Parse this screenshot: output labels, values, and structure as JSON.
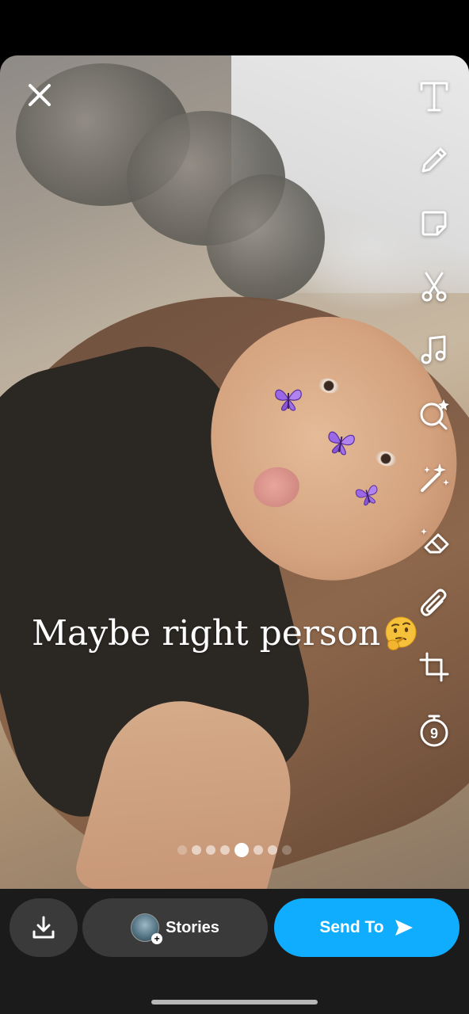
{
  "caption": {
    "text": "Maybe  right person",
    "emoji_icon": "thinking-face-icon"
  },
  "toolbar": {
    "close_icon": "close-icon",
    "tools": [
      "text-tool-icon",
      "pencil-icon",
      "sticker-icon",
      "scissors-icon",
      "music-icon",
      "lens-icon",
      "magic-wand-icon",
      "eraser-icon",
      "paperclip-icon",
      "crop-icon",
      "timer-icon"
    ],
    "timer_value": "9"
  },
  "pagination": {
    "count": 8,
    "active_index": 4
  },
  "bottom_bar": {
    "download_icon": "download-icon",
    "stories_label": "Stories",
    "send_to_label": "Send To",
    "send_icon": "send-arrow-icon"
  },
  "colors": {
    "accent": "#10adff",
    "bar_background": "#1b1b1b",
    "button_background": "#3a3a3a",
    "butterfly": "#8e5ed8"
  }
}
